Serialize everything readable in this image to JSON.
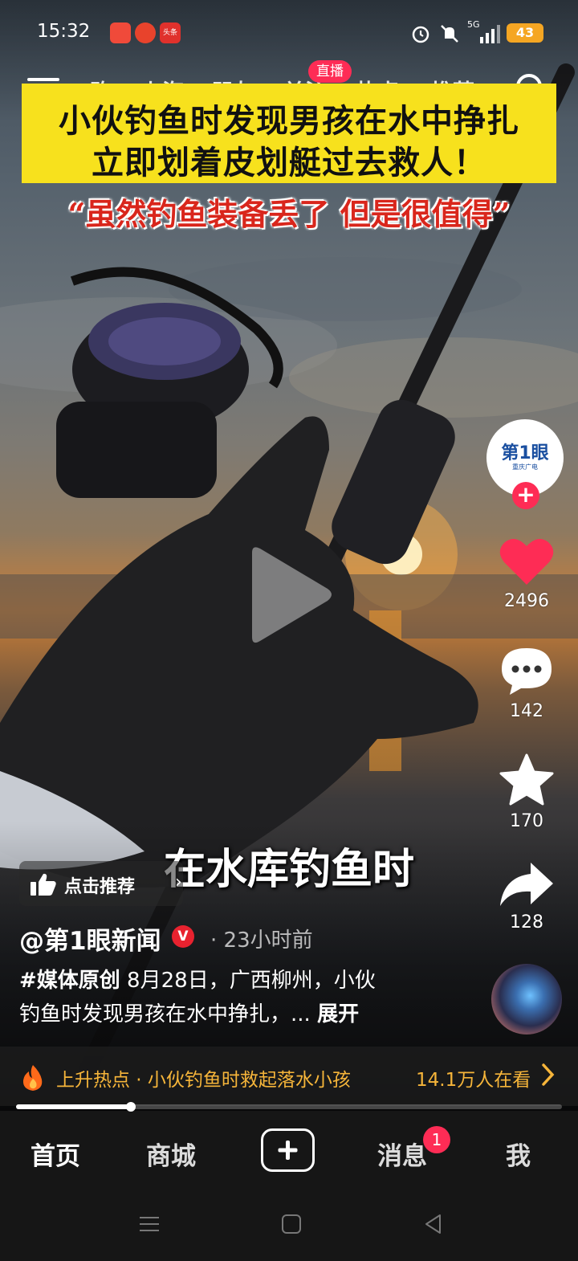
{
  "status_bar": {
    "time": "15:32",
    "notification_badges": [
      "app-icon",
      "bilibili-icon",
      "toutiao-icon"
    ],
    "toutiao_label": "头条",
    "network": "5G",
    "battery": "43"
  },
  "top_nav": {
    "tabs": [
      "购",
      "上海",
      "朋友",
      "关注",
      "热点",
      "推荐"
    ],
    "live_badge": "直播"
  },
  "video": {
    "title_line1": "小伙钓鱼时发现男孩在水中挣扎",
    "title_line2": "立即划着皮划艇过去救人！",
    "quote": "“虽然钓鱼装备丢了 但是很值得”",
    "subtitle": "在水库钓鱼时"
  },
  "author_avatar": {
    "logo_text": "第1眼",
    "logo_sub": "重庆广电"
  },
  "actions": {
    "likes": "2496",
    "comments": "142",
    "favorites": "170",
    "shares": "128"
  },
  "info": {
    "recommend_label": "点击推荐",
    "author": "@第1眼新闻",
    "verified_mark": "V",
    "time_ago": "· 23小时前",
    "hashtag": "#媒体原创",
    "desc_line1": " 8月28日，广西柳州，小伙",
    "desc_line2": "钓鱼时发现男孩在水中挣扎，... ",
    "expand": "展开"
  },
  "hot_bar": {
    "text": "上升热点 · 小伙钓鱼时救起落水小孩",
    "viewers": "14.1万人在看"
  },
  "playback": {
    "progress": 0.21
  },
  "tab_bar": {
    "home": "首页",
    "mall": "商城",
    "messages": "消息",
    "messages_badge": "1",
    "me": "我"
  },
  "colors": {
    "accent": "#fe2c55",
    "title_bg": "#f7e11d",
    "quote_red": "#d9261c",
    "hot_orange": "#f6b53a"
  }
}
